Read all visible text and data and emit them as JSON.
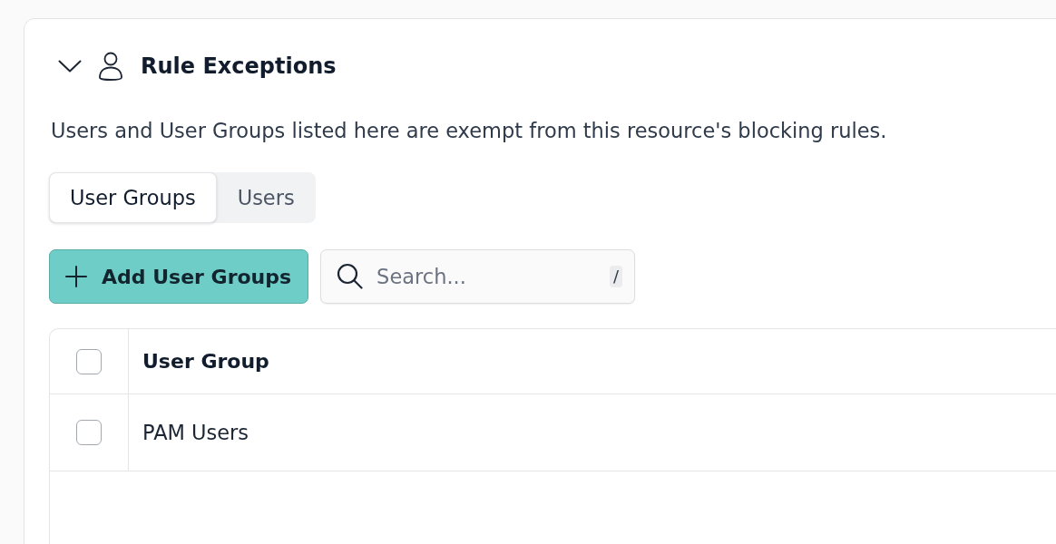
{
  "section": {
    "title": "Rule Exceptions",
    "expanded": true,
    "description": "Users and User Groups listed here are exempt from this resource's blocking rules."
  },
  "tabs": [
    {
      "label": "User Groups",
      "selected": true
    },
    {
      "label": "Users",
      "selected": false
    }
  ],
  "toolbar": {
    "add_button": "Add User Groups",
    "search": {
      "placeholder": "Search...",
      "shortcut": "/"
    }
  },
  "table": {
    "header_checked": false,
    "columns": [
      {
        "label": "User Group"
      }
    ],
    "rows": [
      {
        "checked": false,
        "cells": [
          "PAM Users"
        ]
      }
    ]
  }
}
